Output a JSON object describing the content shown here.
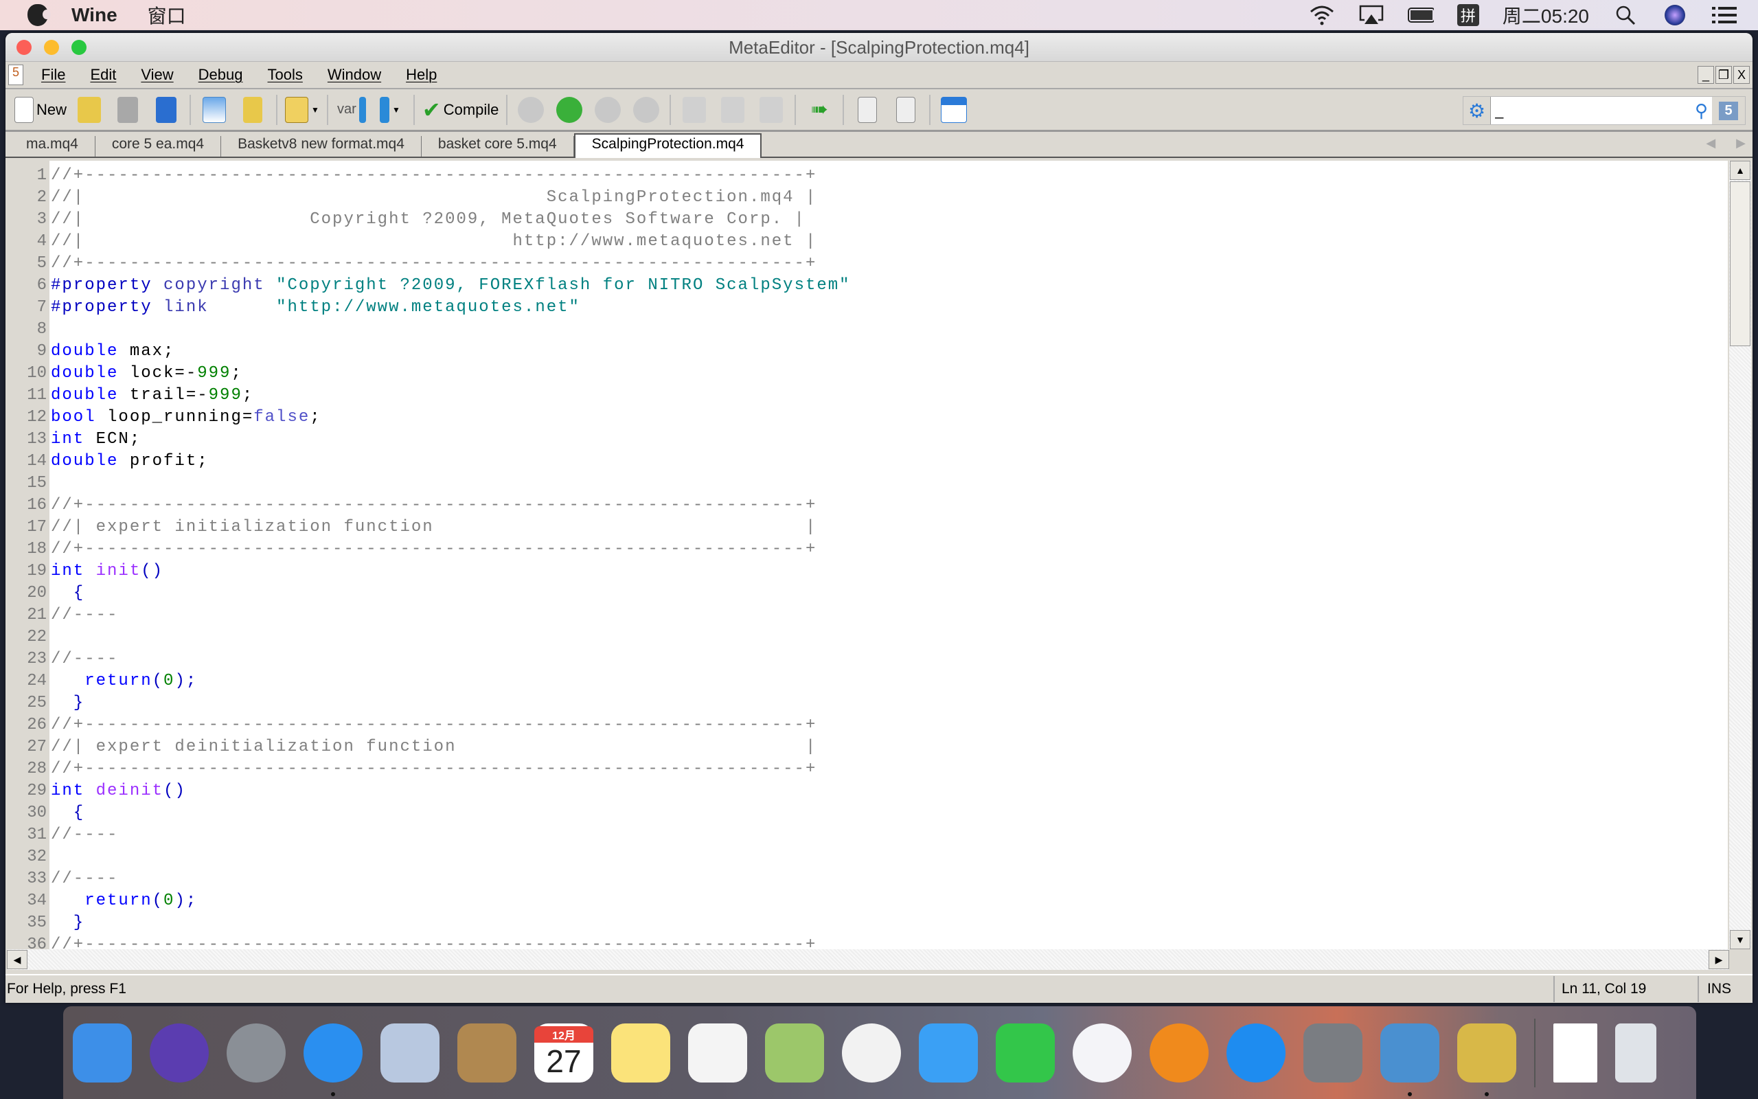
{
  "macos_menubar": {
    "app_name": "Wine",
    "menu": "窗口",
    "input_method": "拼",
    "clock": "周二05:20"
  },
  "window": {
    "title": "MetaEditor - [ScalpingProtection.mq4]"
  },
  "menu": [
    "File",
    "Edit",
    "View",
    "Debug",
    "Tools",
    "Window",
    "Help"
  ],
  "toolbar": {
    "new_label": "New",
    "compile_label": "Compile",
    "var_label": "var",
    "search_value": "_",
    "badge": "5"
  },
  "tabs": [
    {
      "label": "ma.mq4"
    },
    {
      "label": "core 5 ea.mq4"
    },
    {
      "label": "Basketv8 new format.mq4"
    },
    {
      "label": "basket core 5.mq4"
    },
    {
      "label": "ScalpingProtection.mq4",
      "active": true
    }
  ],
  "code": [
    [
      [
        "//+----------------------------------------------------------------+",
        "c"
      ]
    ],
    [
      [
        "//|                                         ScalpingProtection.mq4 |",
        "c"
      ]
    ],
    [
      [
        "//|                    Copyright ?2009, MetaQuotes Software Corp. |",
        "c"
      ]
    ],
    [
      [
        "//|                                      http://www.metaquotes.net |",
        "c"
      ]
    ],
    [
      [
        "//+----------------------------------------------------------------+",
        "c"
      ]
    ],
    [
      [
        "#property",
        "u"
      ],
      [
        " ",
        "d"
      ],
      [
        "copyright",
        "p"
      ],
      [
        " ",
        "d"
      ],
      [
        "\"Copyright ?2009, FOREXflash for NITRO ScalpSystem\"",
        "s"
      ]
    ],
    [
      [
        "#property",
        "u"
      ],
      [
        " ",
        "d"
      ],
      [
        "link",
        "p"
      ],
      [
        "      ",
        "d"
      ],
      [
        "\"http://www.metaquotes.net\"",
        "s"
      ]
    ],
    [],
    [
      [
        "double",
        "k"
      ],
      [
        " max;",
        "d"
      ]
    ],
    [
      [
        "double",
        "k"
      ],
      [
        " lock=-",
        "d"
      ],
      [
        "999",
        "n"
      ],
      [
        ";",
        "d"
      ]
    ],
    [
      [
        "double",
        "k"
      ],
      [
        " trail=-",
        "d"
      ],
      [
        "999",
        "n"
      ],
      [
        ";",
        "d"
      ]
    ],
    [
      [
        "bool",
        "k"
      ],
      [
        " loop_running=",
        "d"
      ],
      [
        "false",
        "b"
      ],
      [
        ";",
        "d"
      ]
    ],
    [
      [
        "int",
        "k"
      ],
      [
        " ECN;",
        "d"
      ]
    ],
    [
      [
        "double",
        "k"
      ],
      [
        " profit;",
        "d"
      ]
    ],
    [],
    [
      [
        "//+----------------------------------------------------------------+",
        "c"
      ]
    ],
    [
      [
        "//| expert initialization function                                 |",
        "c"
      ]
    ],
    [
      [
        "//+----------------------------------------------------------------+",
        "c"
      ]
    ],
    [
      [
        "int",
        "k"
      ],
      [
        " ",
        "d"
      ],
      [
        "init",
        "f"
      ],
      [
        "()",
        "u"
      ]
    ],
    [
      [
        "  {",
        "u"
      ]
    ],
    [
      [
        "//----",
        "c"
      ]
    ],
    [],
    [
      [
        "//----",
        "c"
      ]
    ],
    [
      [
        "   ",
        "d"
      ],
      [
        "return",
        "k"
      ],
      [
        "(",
        "u"
      ],
      [
        "0",
        "n"
      ],
      [
        ");",
        "u"
      ]
    ],
    [
      [
        "  }",
        "u"
      ]
    ],
    [
      [
        "//+----------------------------------------------------------------+",
        "c"
      ]
    ],
    [
      [
        "//| expert deinitialization function                               |",
        "c"
      ]
    ],
    [
      [
        "//+----------------------------------------------------------------+",
        "c"
      ]
    ],
    [
      [
        "int",
        "k"
      ],
      [
        " ",
        "d"
      ],
      [
        "deinit",
        "f"
      ],
      [
        "()",
        "u"
      ]
    ],
    [
      [
        "  {",
        "u"
      ]
    ],
    [
      [
        "//----",
        "c"
      ]
    ],
    [],
    [
      [
        "//----",
        "c"
      ]
    ],
    [
      [
        "   ",
        "d"
      ],
      [
        "return",
        "k"
      ],
      [
        "(",
        "u"
      ],
      [
        "0",
        "n"
      ],
      [
        ");",
        "u"
      ]
    ],
    [
      [
        "  }",
        "u"
      ]
    ],
    [
      [
        "//+----------------------------------------------------------------+",
        "c"
      ]
    ]
  ],
  "status": {
    "help": "For Help, press F1",
    "position": "Ln 11, Col 19",
    "mode": "INS"
  },
  "dock": [
    {
      "name": "finder",
      "color": "#3d8fe8"
    },
    {
      "name": "siri",
      "color": "#5b3db0"
    },
    {
      "name": "launchpad",
      "color": "#8a8f96"
    },
    {
      "name": "safari",
      "color": "#2a8ff0",
      "running": true
    },
    {
      "name": "mail",
      "color": "#b8c8e0"
    },
    {
      "name": "contacts",
      "color": "#b08850"
    },
    {
      "name": "calendar",
      "color": "#ffffff",
      "month": "12月",
      "day": "27"
    },
    {
      "name": "notes",
      "color": "#fbe37a"
    },
    {
      "name": "reminders",
      "color": "#f4f4f4"
    },
    {
      "name": "maps",
      "color": "#9cc76a"
    },
    {
      "name": "photos",
      "color": "#f2f2f2"
    },
    {
      "name": "messages",
      "color": "#3aa0f5"
    },
    {
      "name": "facetime",
      "color": "#33c64a"
    },
    {
      "name": "itunes",
      "color": "#f4f4f8"
    },
    {
      "name": "ibooks",
      "color": "#f08a1c"
    },
    {
      "name": "app-store",
      "color": "#1e8cf0"
    },
    {
      "name": "system-preferences",
      "color": "#7a7d82"
    },
    {
      "name": "metatrader",
      "color": "#4a90d0",
      "running": true
    },
    {
      "name": "wine-app",
      "color": "#d8b848",
      "running": true
    }
  ],
  "dock_right": [
    {
      "name": "document",
      "color": "#ffffff"
    },
    {
      "name": "trash",
      "color": "#dfe3e8"
    }
  ],
  "colors": {
    "keyword": "#0000ff",
    "comment": "#808080",
    "number": "#008000",
    "string": "#008080"
  }
}
